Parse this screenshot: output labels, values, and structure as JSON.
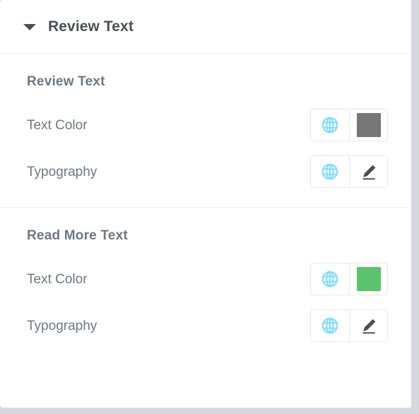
{
  "panel": {
    "header": {
      "title": "Review Text",
      "toggle_icon": "caret-down-icon",
      "expanded": true
    },
    "groups": [
      {
        "title": "Review Text",
        "controls": [
          {
            "label": "Text Color",
            "type": "color",
            "globe_icon": "globe-icon",
            "value": "#767676"
          },
          {
            "label": "Typography",
            "type": "typography",
            "globe_icon": "globe-icon",
            "edit_icon": "pencil-icon"
          }
        ]
      },
      {
        "title": "Read More Text",
        "controls": [
          {
            "label": "Text Color",
            "type": "color",
            "globe_icon": "globe-icon",
            "value": "#5bc46c"
          },
          {
            "label": "Typography",
            "type": "typography",
            "globe_icon": "globe-icon",
            "edit_icon": "pencil-icon"
          }
        ]
      }
    ]
  },
  "theme": {
    "panel_background": "#ffffff",
    "outer_background": "#d5d8dc",
    "header_text": "#495157",
    "group_title_text": "#6d7882",
    "label_text": "#6d7882",
    "divider": "#eef0f2",
    "control_border": "#e6e9ec",
    "globe_accent": "#7fdbff",
    "pencil_color": "#495157"
  }
}
